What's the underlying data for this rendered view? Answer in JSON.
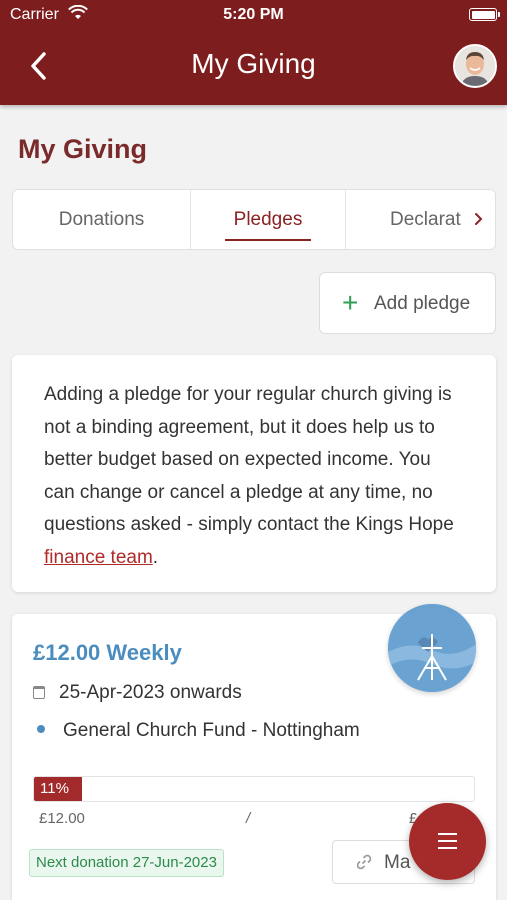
{
  "status_bar": {
    "carrier": "Carrier",
    "time": "5:20 PM"
  },
  "nav": {
    "title": "My Giving",
    "back_icon": "chevron-left-icon",
    "avatar_icon": "user-avatar"
  },
  "page": {
    "title": "My Giving"
  },
  "tabs": [
    {
      "label": "Donations",
      "active": false
    },
    {
      "label": "Pledges",
      "active": true
    },
    {
      "label": "Declarat",
      "active": false
    }
  ],
  "add_pledge": {
    "label": "Add pledge",
    "icon": "plus-icon"
  },
  "info": {
    "text": "Adding a pledge for your regular church giving is not a binding agreement, but it does help us to better budget based on expected income. You can change or cancel a pledge at any time, no questions asked - simply contact the Kings Hope ",
    "link_text": "finance team",
    "suffix": "."
  },
  "pledge": {
    "amount": "£12.00 Weekly",
    "start": "25-Apr-2023 onwards",
    "fund": "General Church Fund - Nottingham",
    "progress_label": "11%",
    "progress_fraction": 0.11,
    "from": "£12.00",
    "separator": "/",
    "to": "£",
    "next_donation": "Next donation 27-Jun-2023",
    "manage_label": "Ma",
    "manage_icon": "link-icon"
  },
  "colors": {
    "header": "#7e1d1d",
    "accent_blue": "#4b8dbf",
    "accent_red": "#a52a2a",
    "green": "#2f9e56"
  }
}
